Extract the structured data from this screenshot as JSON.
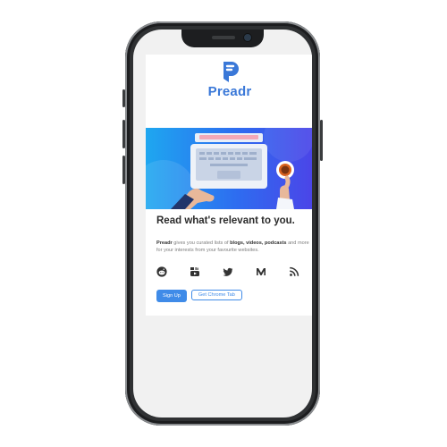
{
  "brand": {
    "name": "Preadr",
    "accent": "#3a78d8"
  },
  "hero": {
    "illustration": "laptop-and-coffee"
  },
  "headline": "Read what's relevant to you.",
  "description": {
    "brand": "Preadr",
    "part1": " gives you curated lists of ",
    "highlight": "blogs, videos, podcasts",
    "part2": " and more for your interests from your favourite websites."
  },
  "social_icons": [
    "reddit-icon",
    "youtube-icon",
    "twitter-icon",
    "medium-icon",
    "rss-icon"
  ],
  "actions": {
    "signup_label": "Sign Up",
    "chrome_label": "Get Chrome Tab"
  },
  "colors": {
    "button": "#3f8be8",
    "hero_start": "#1ea7f0",
    "hero_end": "#4b45e8"
  }
}
